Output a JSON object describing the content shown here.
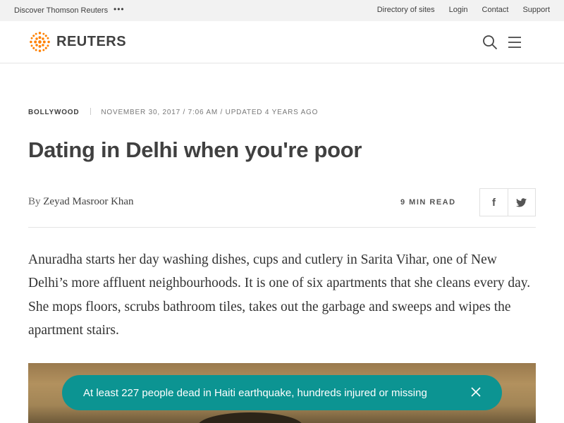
{
  "topbar": {
    "discover": "Discover Thomson Reuters",
    "more": "•••",
    "links": [
      "Directory of sites",
      "Login",
      "Contact",
      "Support"
    ]
  },
  "header": {
    "brand": "REUTERS",
    "brand_color": "#ff8000"
  },
  "article": {
    "section": "BOLLYWOOD",
    "date": "NOVEMBER 30, 2017 / 7:06 AM / UPDATED 4 YEARS AGO",
    "title": "Dating in Delhi when you're poor",
    "by": "By",
    "author": "Zeyad Masroor Khan",
    "read_time": "9 MIN READ",
    "body": "Anuradha starts her day washing dishes, cups and cutlery in Sarita Vihar, one of New Delhi’s more affluent neighbourhoods. It is one of six apartments that she cleans every day. She mops floors, scrubs bathroom tiles, takes out the garbage and sweeps and wipes the apartment stairs."
  },
  "share": {
    "facebook_glyph": "f",
    "twitter_icon": "twitter-icon"
  },
  "toast": {
    "text": "At least 227 people dead in Haiti earthquake, hundreds injured or missing",
    "color": "#0c9492"
  }
}
